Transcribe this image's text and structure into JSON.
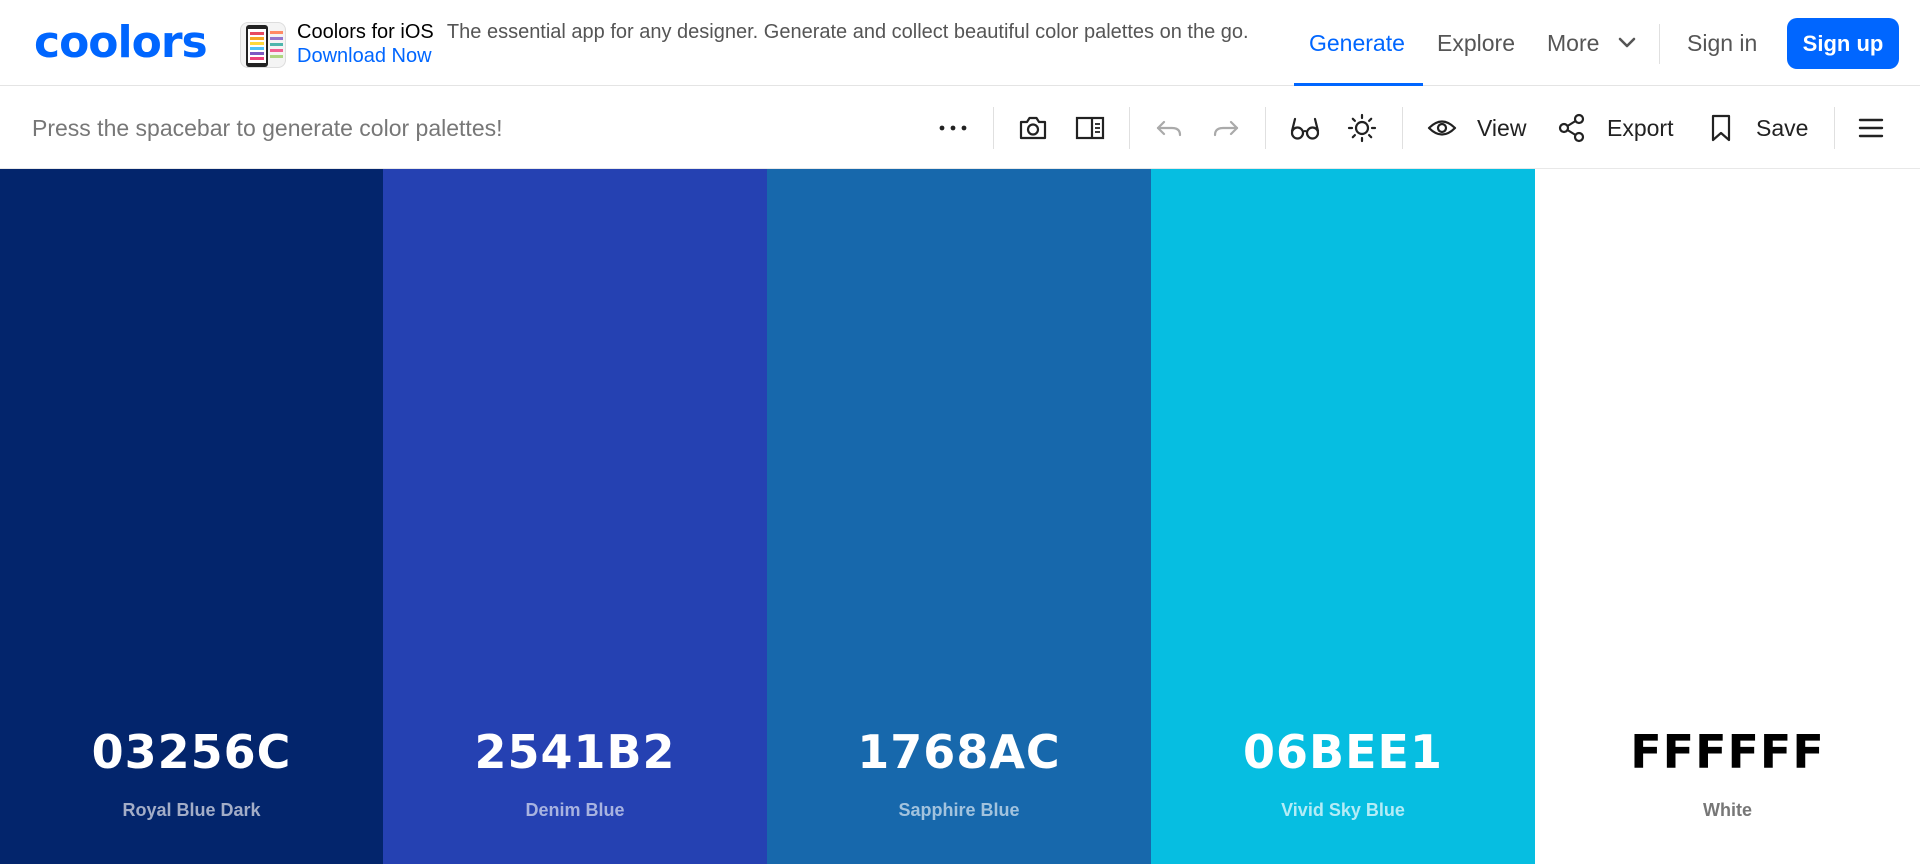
{
  "brand": {
    "logo_text": "coolors",
    "accent": "#0066ff"
  },
  "promo": {
    "title": "Coolors for iOS",
    "text": "The essential app for any designer. Generate and collect beautiful color palettes on the go.",
    "link": "Download Now"
  },
  "nav": {
    "generate": "Generate",
    "explore": "Explore",
    "more": "More",
    "signin": "Sign in",
    "signup": "Sign up",
    "active": "Generate"
  },
  "toolbar": {
    "hint": "Press the spacebar to generate color palettes!",
    "view": "View",
    "export": "Export",
    "save": "Save",
    "icons": [
      "more-options-icon",
      "camera-icon",
      "split-panel-icon",
      "undo-icon",
      "redo-icon",
      "glasses-icon",
      "sun-icon",
      "eye-icon",
      "share-icon",
      "bookmark-icon",
      "menu-icon"
    ]
  },
  "palette": [
    {
      "hex": "03256C",
      "name": "Royal Blue Dark",
      "bg": "#03256c",
      "text_color": "#ffffff",
      "name_color": "#a3adc7"
    },
    {
      "hex": "2541B2",
      "name": "Denim Blue",
      "bg": "#2541b2",
      "text_color": "#ffffff",
      "name_color": "#a8b3e0"
    },
    {
      "hex": "1768AC",
      "name": "Sapphire Blue",
      "bg": "#1768ac",
      "text_color": "#ffffff",
      "name_color": "#a2c3de"
    },
    {
      "hex": "06BEE1",
      "name": "Vivid Sky Blue",
      "bg": "#06bee1",
      "text_color": "#ffffff",
      "name_color": "#b4ecf6"
    },
    {
      "hex": "FFFFFF",
      "name": "White",
      "bg": "#ffffff",
      "text_color": "#000000",
      "name_color": "#777777"
    }
  ]
}
